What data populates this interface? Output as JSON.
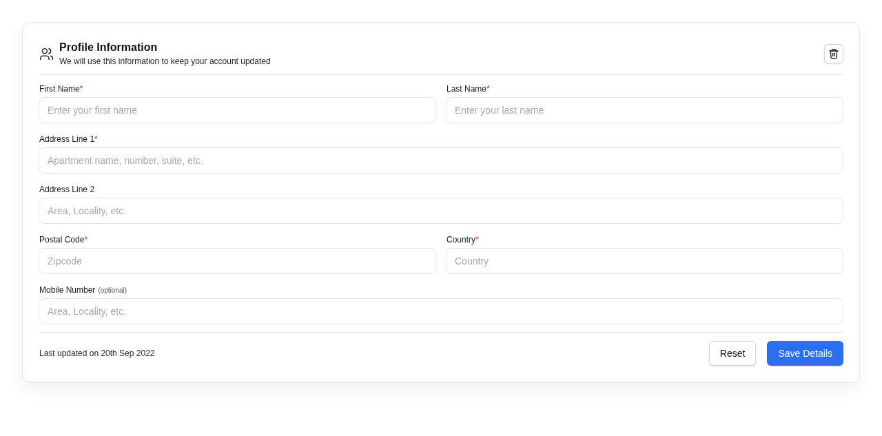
{
  "header": {
    "title": "Profile Information",
    "subtitle": "We will use this information to keep your account updated"
  },
  "rows": [
    [
      {
        "label": "First Name",
        "required_mark": "*",
        "placeholder": "Enter your first name"
      },
      {
        "label": "Last Name",
        "required_mark": "*",
        "placeholder": "Enter your last name"
      }
    ],
    [
      {
        "label": "Address Line 1",
        "required_mark": "*",
        "placeholder": "Apartment name, number, suite, etc."
      }
    ],
    [
      {
        "label": "Address Line 2",
        "placeholder": "Area, Locality, etc."
      }
    ],
    [
      {
        "label": "Postal Code",
        "required_mark": "*",
        "placeholder": "Zipcode"
      },
      {
        "label": "Country",
        "required_mark": "*",
        "placeholder": "Country"
      }
    ],
    [
      {
        "label": "Mobile Number",
        "note": "(optional)",
        "placeholder": "Area, Locality, etc."
      }
    ]
  ],
  "footer": {
    "last_updated": "Last updated on 20th Sep 2022",
    "buttons": [
      {
        "label": "Reset",
        "kind": "secondary"
      },
      {
        "label": "Save Details",
        "kind": "primary"
      }
    ]
  }
}
